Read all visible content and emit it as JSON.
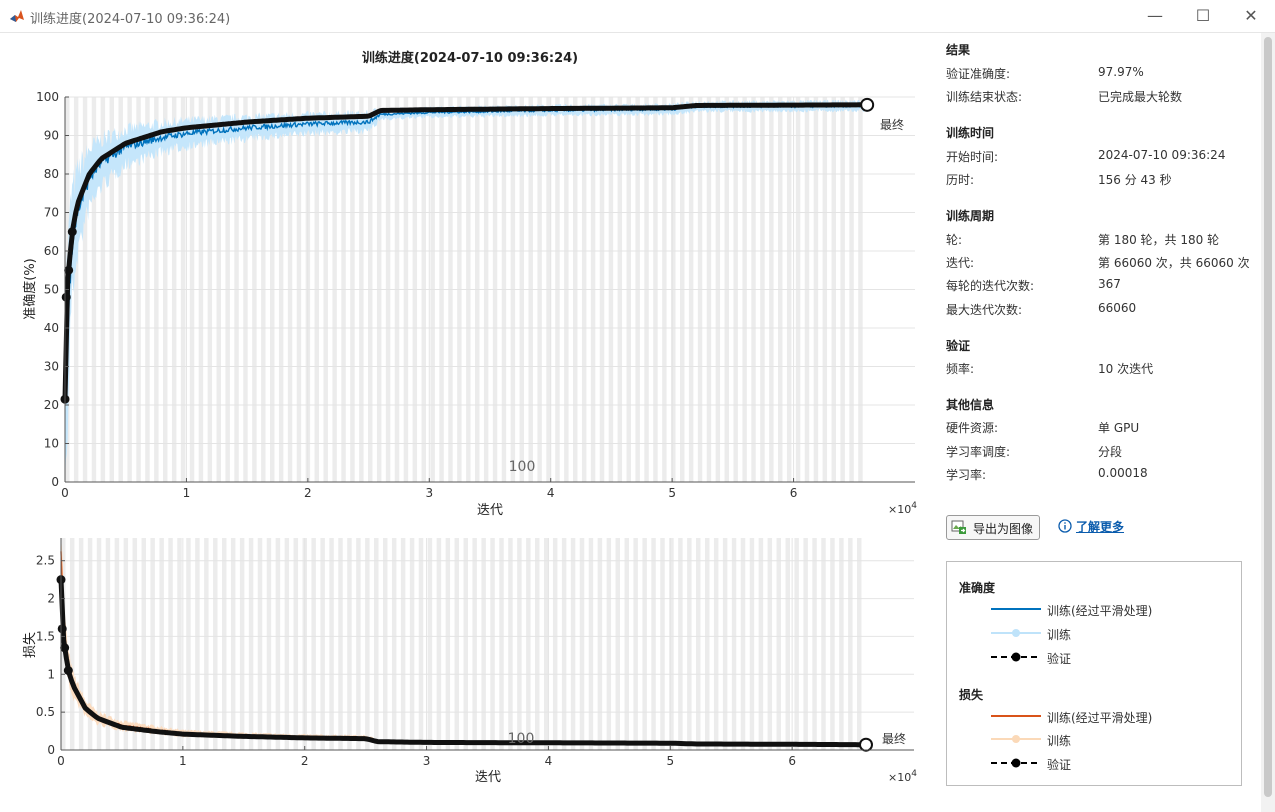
{
  "window": {
    "title": "训练进度(2024-07-10 09:36:24)",
    "minimize": "—",
    "maximize": "☐",
    "close": "✕"
  },
  "accuracy_chart": {
    "title": "训练进度(2024-07-10 09:36:24)",
    "ylabel": "准确度(%)",
    "xlabel": "迭代",
    "x_exponent": "×10",
    "x_exponent_power": "4",
    "yticks": [
      "0",
      "10",
      "20",
      "30",
      "40",
      "50",
      "60",
      "70",
      "80",
      "90",
      "100"
    ],
    "xticks": [
      "0",
      "1",
      "2",
      "3",
      "4",
      "5",
      "6"
    ],
    "epoch_marker": "100",
    "final_label": "最终"
  },
  "loss_chart": {
    "ylabel": "损失",
    "xlabel": "迭代",
    "x_exponent": "×10",
    "x_exponent_power": "4",
    "yticks": [
      "0",
      "0.5",
      "1",
      "1.5",
      "2",
      "2.5"
    ],
    "xticks": [
      "0",
      "1",
      "2",
      "3",
      "4",
      "5",
      "6"
    ],
    "epoch_marker": "100",
    "final_label": "最终"
  },
  "chart_data": [
    {
      "type": "line",
      "ylabel": "准确度(%)",
      "xlabel": "迭代",
      "xlim": [
        0,
        70000
      ],
      "ylim": [
        0,
        100
      ],
      "series": [
        {
          "name": "训练(经过平滑处理)",
          "color": "#0072bd",
          "x": [
            0,
            500,
            1000,
            2000,
            3000,
            5000,
            8000,
            10000,
            15000,
            20000,
            25000,
            26000,
            30000,
            40000,
            50000,
            52000,
            60000,
            66060
          ],
          "y": [
            20,
            60,
            70,
            79,
            83,
            87,
            89.5,
            90.5,
            92,
            93,
            93.5,
            95.5,
            96,
            96.5,
            96.8,
            97.5,
            97.6,
            97.7
          ]
        },
        {
          "name": "验证",
          "color": "#000000",
          "x": [
            0,
            100,
            300,
            600,
            1000,
            2000,
            3000,
            5000,
            8000,
            10000,
            15000,
            20000,
            25000,
            26000,
            30000,
            40000,
            50000,
            52000,
            60000,
            66060
          ],
          "y": [
            21.5,
            48,
            55,
            65,
            72,
            80,
            84,
            88,
            91,
            92,
            93.5,
            94.5,
            95,
            96.5,
            96.7,
            97,
            97.2,
            97.8,
            97.9,
            97.97
          ]
        }
      ]
    },
    {
      "type": "line",
      "ylabel": "损失",
      "xlabel": "迭代",
      "xlim": [
        0,
        70000
      ],
      "ylim": [
        0,
        2.8
      ],
      "series": [
        {
          "name": "训练(经过平滑处理)",
          "color": "#d95319",
          "x": [
            0,
            300,
            600,
            1000,
            2000,
            3000,
            5000,
            8000,
            10000,
            15000,
            20000,
            25000,
            26000,
            30000,
            40000,
            50000,
            52000,
            60000,
            66060
          ],
          "y": [
            2.6,
            1.5,
            1.1,
            0.85,
            0.55,
            0.42,
            0.32,
            0.26,
            0.22,
            0.19,
            0.17,
            0.16,
            0.11,
            0.1,
            0.095,
            0.09,
            0.08,
            0.075,
            0.07
          ]
        },
        {
          "name": "验证",
          "color": "#000000",
          "x": [
            0,
            100,
            300,
            600,
            1000,
            2000,
            3000,
            5000,
            8000,
            10000,
            15000,
            20000,
            25000,
            26000,
            30000,
            40000,
            50000,
            52000,
            60000,
            66060
          ],
          "y": [
            2.25,
            1.6,
            1.35,
            1.05,
            0.85,
            0.55,
            0.42,
            0.3,
            0.24,
            0.21,
            0.18,
            0.16,
            0.15,
            0.11,
            0.1,
            0.095,
            0.09,
            0.08,
            0.075,
            0.07
          ]
        }
      ]
    }
  ],
  "panel": {
    "results": {
      "heading": "结果",
      "rows": [
        {
          "label": "验证准确度:",
          "value": "97.97%"
        },
        {
          "label": "训练结束状态:",
          "value": "已完成最大轮数"
        }
      ]
    },
    "time": {
      "heading": "训练时间",
      "rows": [
        {
          "label": "开始时间:",
          "value": "2024-07-10 09:36:24"
        },
        {
          "label": "历时:",
          "value": "156 分 43 秒"
        }
      ]
    },
    "cycle": {
      "heading": "训练周期",
      "rows": [
        {
          "label": "轮:",
          "value": "第 180 轮，共 180 轮"
        },
        {
          "label": "迭代:",
          "value": "第 66060 次，共 66060 次"
        },
        {
          "label": "每轮的迭代次数:",
          "value": "367"
        },
        {
          "label": "最大迭代次数:",
          "value": "66060"
        }
      ]
    },
    "validation": {
      "heading": "验证",
      "rows": [
        {
          "label": "频率:",
          "value": "10 次迭代"
        }
      ]
    },
    "other": {
      "heading": "其他信息",
      "rows": [
        {
          "label": "硬件资源:",
          "value": "单 GPU"
        },
        {
          "label": "学习率调度:",
          "value": "分段"
        },
        {
          "label": "学习率:",
          "value": "0.00018"
        }
      ]
    },
    "export_label": "导出为图像",
    "learn_more": "了解更多"
  },
  "legend": {
    "accuracy_heading": "准确度",
    "loss_heading": "损失",
    "smoothed": "训练(经过平滑处理)",
    "training": "训练",
    "validation": "验证",
    "colors": {
      "acc_smoothed": "#0072bd",
      "acc_training": "#bfe3fa",
      "loss_smoothed": "#d95319",
      "loss_training": "#fbd9b8",
      "validation": "#000000"
    }
  }
}
